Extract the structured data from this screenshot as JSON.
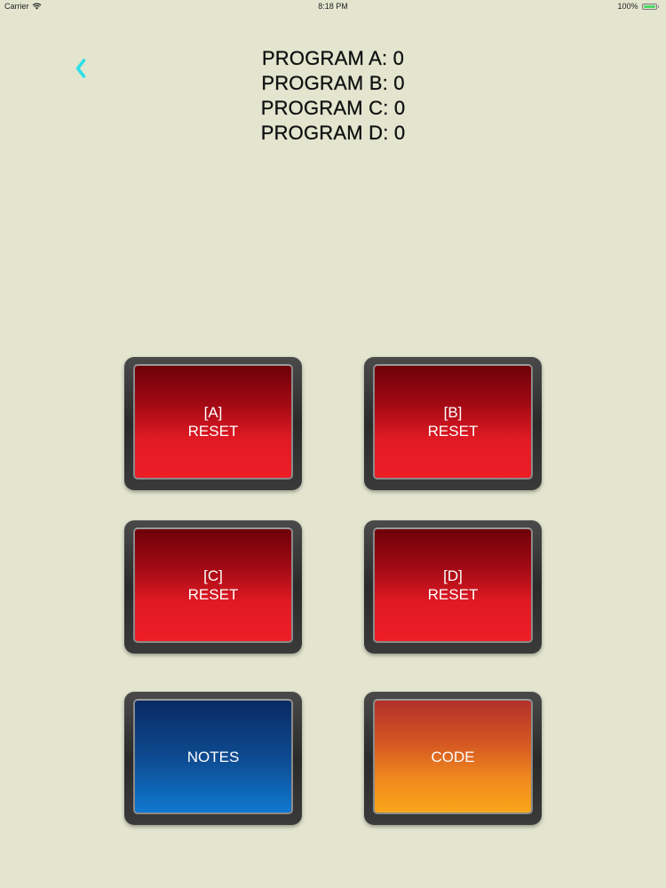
{
  "status_bar": {
    "carrier": "Carrier",
    "time": "8:18 PM",
    "battery_percent": "100%",
    "battery_level": 1.0,
    "battery_color": "#4cd964"
  },
  "nav": {
    "back_icon": "chevron-left-icon",
    "back_color": "#2de0e6"
  },
  "programs": [
    {
      "text": "PROGRAM A: 0"
    },
    {
      "text": "PROGRAM B: 0"
    },
    {
      "text": "PROGRAM C: 0"
    },
    {
      "text": "PROGRAM D: 0"
    }
  ],
  "buttons": {
    "reset_a": {
      "line1": "[A]",
      "line2": "RESET"
    },
    "reset_b": {
      "line1": "[B]",
      "line2": "RESET"
    },
    "reset_c": {
      "line1": "[C]",
      "line2": "RESET"
    },
    "reset_d": {
      "line1": "[D]",
      "line2": "RESET"
    },
    "notes": {
      "label": "NOTES"
    },
    "code": {
      "label": "CODE"
    }
  },
  "colors": {
    "background": "#e3e5cf",
    "reset_red": "#e01a24",
    "notes_blue": "#0d4a8f",
    "code_orange": "#f08a1e"
  }
}
